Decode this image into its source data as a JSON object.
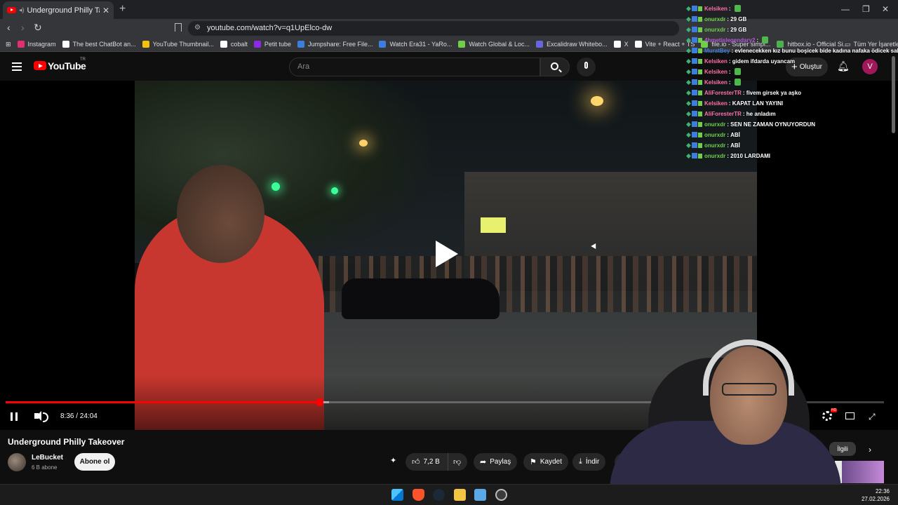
{
  "browser": {
    "tab_title": "Underground Philly Takeover",
    "url": "youtube.com/watch?v=q1UpElco-dw",
    "bookmarks": [
      {
        "label": "Instagram",
        "color": "#e1306c"
      },
      {
        "label": "The best ChatBot an...",
        "color": "#ffffff"
      },
      {
        "label": "YouTube Thumbnail...",
        "color": "#f4c20d"
      },
      {
        "label": "cobalt",
        "color": "#ffffff"
      },
      {
        "label": "Petit tube",
        "color": "#8a2be2"
      },
      {
        "label": "Jumpshare: Free File...",
        "color": "#3d7ddc"
      },
      {
        "label": "Watch Era31 - YaRo...",
        "color": "#3d7ddc"
      },
      {
        "label": "Watch Global & Loc...",
        "color": "#6fcf4a"
      },
      {
        "label": "Excalidraw Whitebo...",
        "color": "#6965db"
      },
      {
        "label": "X",
        "color": "#ffffff"
      },
      {
        "label": "Vite + React + TS",
        "color": "#ffffff"
      },
      {
        "label": "file.io - Super simpl...",
        "color": "#6fcf4a"
      },
      {
        "label": "hitbox.io - Official Si...",
        "color": "#4caf50"
      }
    ],
    "all_bookmarks": "Tüm Yer İşaretleri"
  },
  "youtube": {
    "logo_text": "YouTube",
    "region": "TR",
    "search_placeholder": "Ara",
    "create_label": "Oluştur",
    "avatar_letter": "V"
  },
  "player": {
    "current_time": "8:36",
    "duration": "24:04",
    "timecode": "8:36 / 24:04",
    "progress_fraction": 0.357,
    "buffer_fraction": 0.368
  },
  "video": {
    "title": "Underground Philly Takeover",
    "channel": "LeBucket",
    "subscribers": "6 B abone",
    "subscribe_label": "Abone ol",
    "likes": "7,2 B",
    "share_label": "Paylaş",
    "save_label": "Kaydet",
    "download_label": "İndir",
    "related_label": "İlgili"
  },
  "chat": [
    {
      "user": "Kelsiken",
      "color": "#ff6ea8",
      "msg": ""
    },
    {
      "user": "onurxdr",
      "color": "#6fcf4a",
      "msg": "29 GB"
    },
    {
      "user": "onurxdr",
      "color": "#6fcf4a",
      "msg": "29 GB"
    },
    {
      "user": "4hmetislegendary2",
      "color": "#b45cd6",
      "msg": ""
    },
    {
      "user": "MuratBey",
      "color": "#3d7ddc",
      "msg": "evlenecekken kız bunu boşicek bide kadına nafaka ödicek salak"
    },
    {
      "user": "Kelsiken",
      "color": "#ff6ea8",
      "msg": "gidem ifdarda uyancam"
    },
    {
      "user": "Kelsiken",
      "color": "#ff6ea8",
      "msg": ""
    },
    {
      "user": "Kelsiken",
      "color": "#ff6ea8",
      "msg": ""
    },
    {
      "user": "AliForesterTR",
      "color": "#ff6ea8",
      "msg": "fivem girsek ya aşko"
    },
    {
      "user": "Kelsiken",
      "color": "#ff6ea8",
      "msg": "KAPAT LAN YAYINI"
    },
    {
      "user": "AliForesterTR",
      "color": "#ff6ea8",
      "msg": "he anladım"
    },
    {
      "user": "onurxdr",
      "color": "#6fcf4a",
      "msg": "SEN NE ZAMAN OYNUYORDUN"
    },
    {
      "user": "onurxdr",
      "color": "#6fcf4a",
      "msg": "ABİ"
    },
    {
      "user": "onurxdr",
      "color": "#6fcf4a",
      "msg": "ABİ"
    },
    {
      "user": "onurxdr",
      "color": "#6fcf4a",
      "msg": "2010 LARDAMI"
    }
  ],
  "taskbar": {
    "time": "22:36",
    "date": "27.02.2026"
  }
}
